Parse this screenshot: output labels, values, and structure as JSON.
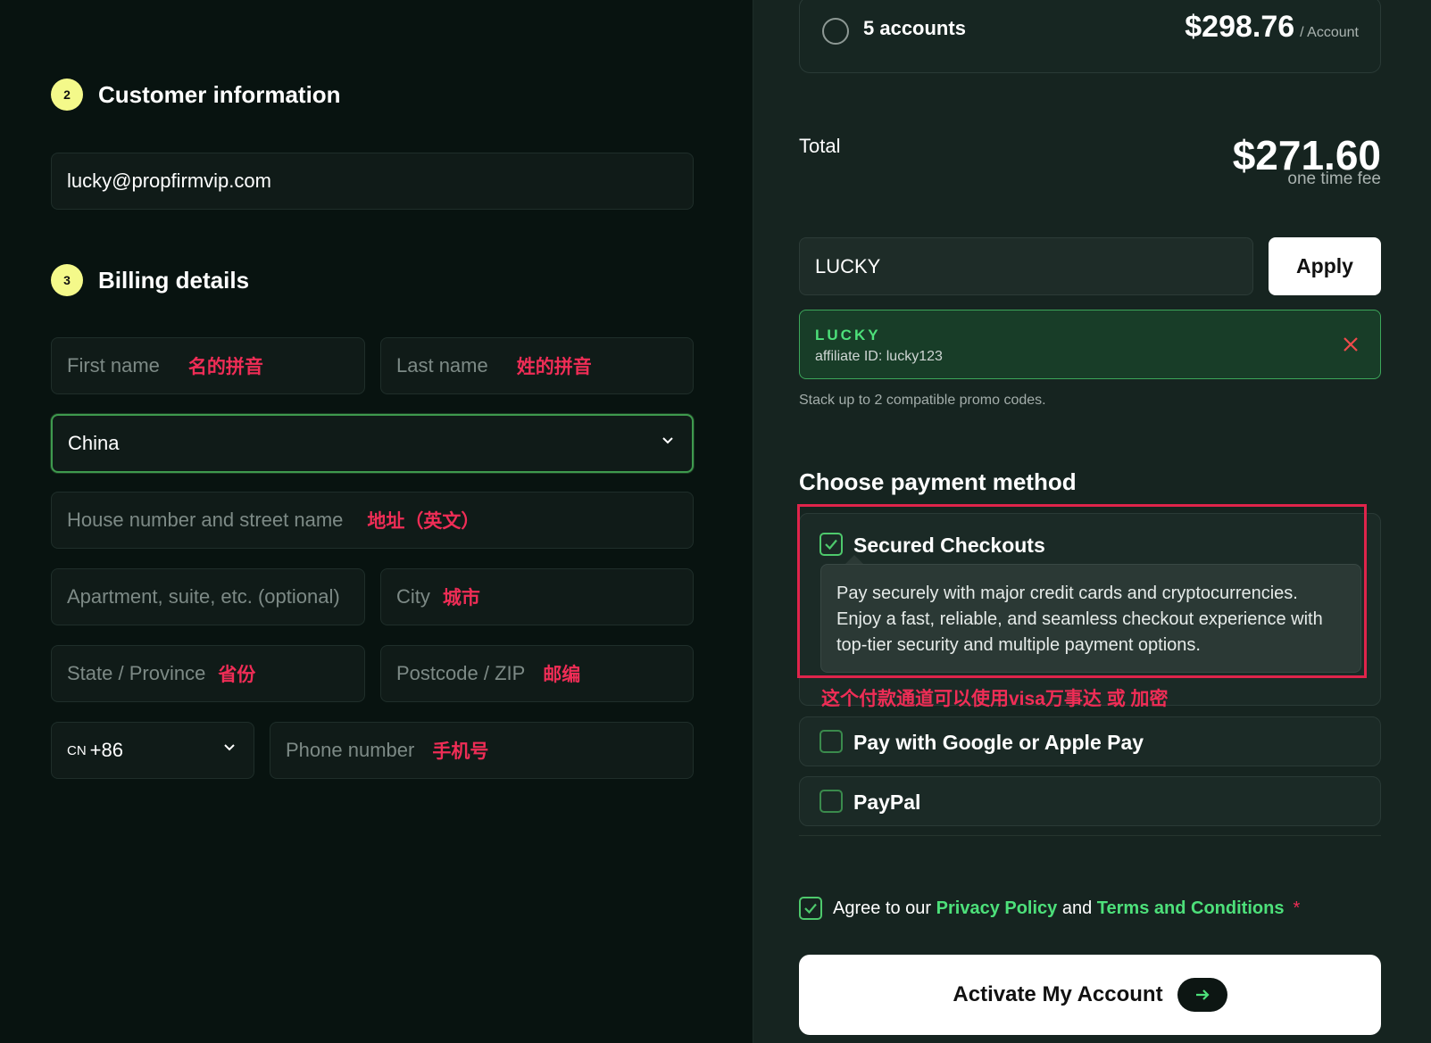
{
  "customer": {
    "step_number": "2",
    "title": "Customer information",
    "email_value": "lucky@propfirmvip.com"
  },
  "billing": {
    "step_number": "3",
    "title": "Billing details",
    "first_name": {
      "placeholder": "First name",
      "note": "名的拼音"
    },
    "last_name": {
      "placeholder": "Last name",
      "note": "姓的拼音"
    },
    "country_value": "China",
    "street": {
      "placeholder": "House number and street name",
      "note": "地址（英文）"
    },
    "apartment": {
      "placeholder": "Apartment, suite, etc. (optional)"
    },
    "city": {
      "placeholder": "City",
      "note": "城市"
    },
    "state": {
      "placeholder": "State / Province",
      "note": "省份"
    },
    "postcode": {
      "placeholder": "Postcode / ZIP",
      "note": "邮编"
    },
    "phone_code": {
      "flag_code": "CN",
      "dial_code": "+86"
    },
    "phone": {
      "placeholder": "Phone number",
      "note": "手机号"
    }
  },
  "order": {
    "account_option": {
      "label": "5 accounts",
      "price": "$298.76",
      "unit": "/ Account"
    },
    "total_label": "Total",
    "total_amount": "$271.60",
    "total_sub": "one time fee"
  },
  "promo": {
    "input_value": "LUCKY",
    "apply_label": "Apply",
    "applied_code": "LUCKY",
    "applied_affiliate": "affiliate ID: lucky123",
    "stack_note": "Stack up to 2 compatible promo codes."
  },
  "payment": {
    "title": "Choose payment method",
    "methods": [
      {
        "label": "Secured Checkouts",
        "checked": true,
        "description": "Pay securely with major credit cards and cryptocurrencies. Enjoy a fast, reliable, and seamless checkout experience with top-tier security and multiple payment options."
      },
      {
        "label": "Pay with Google or Apple Pay",
        "checked": false
      },
      {
        "label": "PayPal",
        "checked": false
      }
    ],
    "annotation_note": "这个付款通道可以使用visa万事达 或 加密"
  },
  "agree": {
    "prefix": "Agree to our",
    "privacy_link": "Privacy Policy",
    "middle": "and",
    "terms_link": "Terms and Conditions",
    "required_mark": "*"
  },
  "cta": {
    "label": "Activate My Account"
  },
  "colors": {
    "accent_green": "#4de07a",
    "step_badge": "#f4f98a",
    "annotation_red": "#ef2d56"
  }
}
